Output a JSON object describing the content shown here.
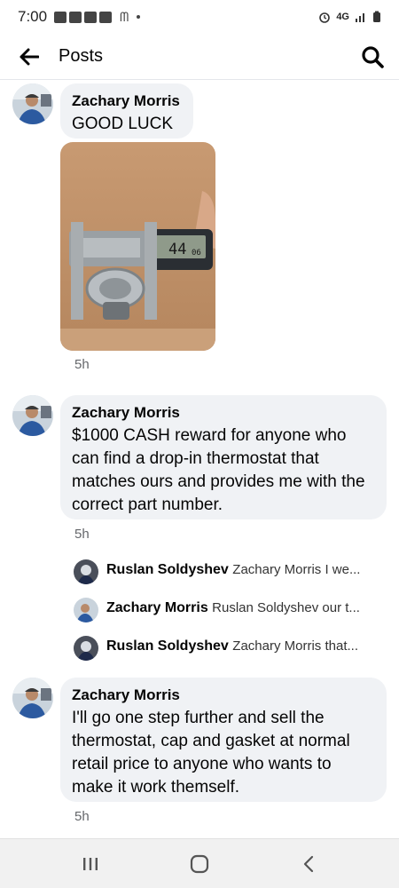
{
  "status_bar": {
    "time": "7:00",
    "network": "4G",
    "icons": [
      "notification-icon",
      "mcdonalds-icon",
      "alarm-icon",
      "signal-icon",
      "battery-icon"
    ]
  },
  "header": {
    "back_icon": "arrow-left-icon",
    "title": "Posts",
    "search_icon": "search-icon"
  },
  "comments": [
    {
      "author": "Zachary Morris",
      "text": "GOOD LUCK",
      "time": "5h",
      "has_photo": true
    },
    {
      "author": "Zachary Morris",
      "text": "$1000 CASH reward for anyone who can find a drop-in thermostat that matches ours and provides me with the correct part number.",
      "time": "5h",
      "replies": [
        {
          "author": "Ruslan Soldyshev",
          "text": "Zachary Morris I we..."
        },
        {
          "author": "Zachary Morris",
          "text": "Ruslan Soldyshev our t..."
        },
        {
          "author": "Ruslan Soldyshev",
          "text": "Zachary Morris that..."
        }
      ]
    },
    {
      "author": "Zachary Morris",
      "text": "I'll go one step further and sell the thermostat, cap and gasket at normal retail price to anyone who wants to make it work themself.",
      "time": "5h"
    }
  ],
  "photo": {
    "caliper_reading": "44",
    "caliper_decimals": "06"
  },
  "nav": {
    "icons": [
      "recent-apps-icon",
      "home-icon",
      "back-nav-icon"
    ]
  },
  "colors": {
    "bubble": "#f0f2f5",
    "text": "#050505",
    "secondary": "#65676b"
  }
}
